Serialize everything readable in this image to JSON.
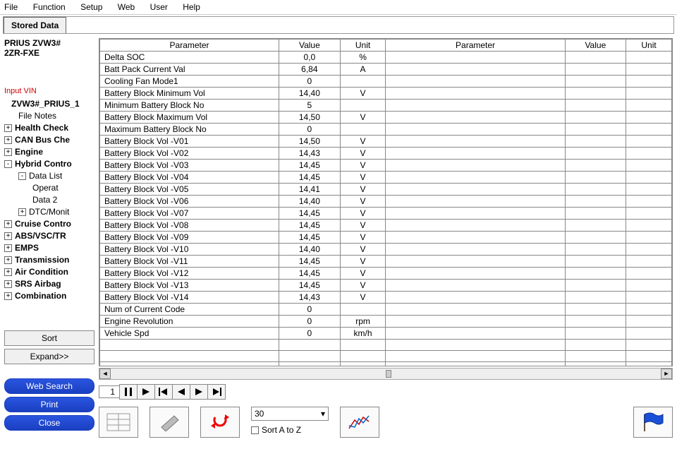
{
  "menu": [
    "File",
    "Function",
    "Setup",
    "Web",
    "User",
    "Help"
  ],
  "tab_label": "Stored Data",
  "vehicle": {
    "line1": "PRIUS ZVW3#",
    "line2": "2ZR-FXE"
  },
  "input_vin": "Input VIN",
  "tree": {
    "root": "ZVW3#_PRIUS_1",
    "file_notes": "File Notes",
    "health": "Health Check",
    "canbus": "CAN Bus Che",
    "engine": "Engine",
    "hybrid": "Hybrid Contro",
    "data_list": "Data List",
    "operat": "Operat",
    "data2": "Data 2",
    "dtc": "DTC/Monit",
    "cruise": "Cruise Contro",
    "abs": "ABS/VSC/TR",
    "emps": "EMPS",
    "trans": "Transmission",
    "airc": "Air Condition",
    "srs": "SRS Airbag",
    "comb": "Combination"
  },
  "buttons": {
    "sort": "Sort",
    "expand": "Expand>>",
    "web": "Web Search",
    "print": "Print",
    "close": "Close"
  },
  "headers": {
    "param": "Parameter",
    "value": "Value",
    "unit": "Unit"
  },
  "rows": [
    {
      "p": "Delta SOC",
      "v": "0,0",
      "u": "%"
    },
    {
      "p": "Batt Pack Current Val",
      "v": "6,84",
      "u": "A"
    },
    {
      "p": "Cooling Fan Mode1",
      "v": "0",
      "u": ""
    },
    {
      "p": "Battery Block Minimum Vol",
      "v": "14,40",
      "u": "V"
    },
    {
      "p": "Minimum Battery Block No",
      "v": "5",
      "u": ""
    },
    {
      "p": "Battery Block Maximum Vol",
      "v": "14,50",
      "u": "V"
    },
    {
      "p": "Maximum Battery Block No",
      "v": "0",
      "u": ""
    },
    {
      "p": "Battery Block Vol -V01",
      "v": "14,50",
      "u": "V"
    },
    {
      "p": "Battery Block Vol -V02",
      "v": "14,43",
      "u": "V"
    },
    {
      "p": "Battery Block Vol -V03",
      "v": "14,45",
      "u": "V"
    },
    {
      "p": "Battery Block Vol -V04",
      "v": "14,45",
      "u": "V"
    },
    {
      "p": "Battery Block Vol -V05",
      "v": "14,41",
      "u": "V"
    },
    {
      "p": "Battery Block Vol -V06",
      "v": "14,40",
      "u": "V"
    },
    {
      "p": "Battery Block Vol -V07",
      "v": "14,45",
      "u": "V"
    },
    {
      "p": "Battery Block Vol -V08",
      "v": "14,45",
      "u": "V"
    },
    {
      "p": "Battery Block Vol -V09",
      "v": "14,45",
      "u": "V"
    },
    {
      "p": "Battery Block Vol -V10",
      "v": "14,40",
      "u": "V"
    },
    {
      "p": "Battery Block Vol -V11",
      "v": "14,45",
      "u": "V"
    },
    {
      "p": "Battery Block Vol -V12",
      "v": "14,45",
      "u": "V"
    },
    {
      "p": "Battery Block Vol -V13",
      "v": "14,45",
      "u": "V"
    },
    {
      "p": "Battery Block Vol -V14",
      "v": "14,43",
      "u": "V"
    },
    {
      "p": "Num of Current Code",
      "v": "0",
      "u": ""
    },
    {
      "p": "Engine Revolution",
      "v": "0",
      "u": "rpm"
    },
    {
      "p": "Vehicle Spd",
      "v": "0",
      "u": "km/h"
    }
  ],
  "empty_rows": 3,
  "playback": {
    "frame": "1"
  },
  "dropdown_value": "30",
  "sort_label": "Sort A to Z"
}
